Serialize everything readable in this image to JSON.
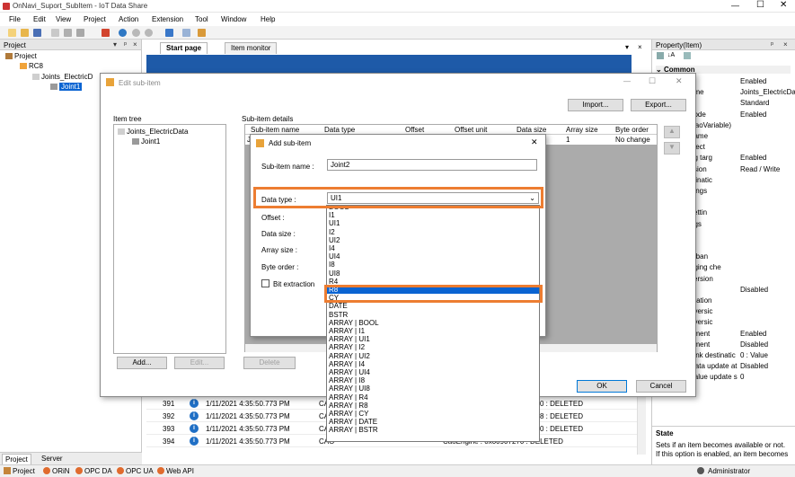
{
  "window": {
    "title": "OnNavi_Suport_SubItem - IoT Data Share"
  },
  "menu": [
    "File",
    "Edit",
    "View",
    "Project",
    "Action",
    "Extension",
    "Tool",
    "Window",
    "Help"
  ],
  "project_panel": {
    "title": "Project",
    "tree": [
      "Project",
      "RC8",
      "Joints_ElectricD",
      "Joint1"
    ]
  },
  "center": {
    "tabs": [
      "Start page",
      "Item monitor"
    ],
    "log_rows": [
      {
        "no": "391",
        "time": "1/11/2021 4:35:50.773 PM",
        "src": "CA",
        "msg": "0 : DELETED"
      },
      {
        "no": "392",
        "time": "1/11/2021 4:35:50.773 PM",
        "src": "CA",
        "msg": "8 : DELETED"
      },
      {
        "no": "393",
        "time": "1/11/2021 4:35:50.773 PM",
        "src": "CA",
        "msg": "0 : DELETED"
      },
      {
        "no": "394",
        "time": "1/11/2021 4:35:50.773 PM",
        "src": "CAO",
        "msg": "CaoEngine : 0x00907270 : DELETED"
      }
    ]
  },
  "property_panel": {
    "title": "Property(Item)",
    "section": "Common",
    "rows": [
      {
        "k": "",
        "v": "Enabled"
      },
      {
        "k": "ame",
        "v": "Joints_ElectricData(Jo"
      },
      {
        "k": "",
        "v": "Standard"
      },
      {
        "k": "node",
        "v": "Enabled"
      },
      {
        "k": "CaoVariable)",
        "v": ""
      },
      {
        "k": "name",
        "v": ""
      },
      {
        "k": "bject",
        "v": ""
      },
      {
        "k": "ng targ",
        "v": "Enabled"
      },
      {
        "k": "ssion",
        "v": "Read / Write"
      },
      {
        "k": "stinatic",
        "v": ""
      },
      {
        "k": "ttings",
        "v": ""
      },
      {
        "k": "n",
        "v": ""
      },
      {
        "k": "settin",
        "v": ""
      },
      {
        "k": "ngs",
        "v": ""
      },
      {
        "k": "er",
        "v": ""
      },
      {
        "k": "d",
        "v": ""
      },
      {
        "k": "n ban",
        "v": ""
      },
      {
        "k": "nging che",
        "v": ""
      },
      {
        "k": "version",
        "v": ""
      },
      {
        "k": "",
        "v": "Disabled"
      },
      {
        "k": "eration",
        "v": ""
      },
      {
        "k": "nversic",
        "v": ""
      },
      {
        "k": "nversic",
        "v": ""
      },
      {
        "k": "ement",
        "v": "Enabled"
      },
      {
        "k": "ement",
        "v": "Disabled"
      },
      {
        "k": "Link destinatic",
        "v": "0 : Value"
      },
      {
        "k": "Data update at",
        "v": "Disabled"
      },
      {
        "k": "Value update s",
        "v": "0"
      }
    ],
    "state_title": "State",
    "state_desc": "Sets if an item becomes available or not. If this option is enabled, an item becomes"
  },
  "bottom_tabs": [
    "Project",
    "Server"
  ],
  "status": {
    "items": [
      "Project",
      "ORiN",
      "OPC DA",
      "OPC UA",
      "Web API"
    ],
    "user": "Administrator"
  },
  "edit_dialog": {
    "title": "Edit sub-item",
    "import": "Import...",
    "export": "Export...",
    "item_tree_label": "Item tree",
    "tree": [
      "Joints_ElectricData",
      "Joint1"
    ],
    "details_label": "Sub-item details",
    "columns": [
      "Sub-item name",
      "Data type",
      "Offset",
      "Offset unit",
      "Data size",
      "Array size",
      "Byte order"
    ],
    "row": {
      "name": "Jo",
      "array": "1",
      "byte": "No change"
    },
    "add": "Add...",
    "edit": "Edit...",
    "delete": "Delete",
    "ok": "OK",
    "cancel": "Cancel"
  },
  "add_dialog": {
    "title": "Add sub-item",
    "name_label": "Sub-item name :",
    "name_value": "Joint2",
    "data_type_label": "Data type :",
    "data_type_value": "UI1",
    "offset_label": "Offset :",
    "data_size_label": "Data size :",
    "array_size_label": "Array size :",
    "byte_order_label": "Byte order :",
    "bit_extraction_label": "Bit extraction",
    "options": [
      "BOOL",
      "I1",
      "UI1",
      "I2",
      "UI2",
      "I4",
      "UI4",
      "I8",
      "UI8",
      "R4",
      "R8",
      "CY",
      "DATE",
      "BSTR",
      "ARRAY | BOOL",
      "ARRAY | I1",
      "ARRAY | UI1",
      "ARRAY | I2",
      "ARRAY | UI2",
      "ARRAY | I4",
      "ARRAY | UI4",
      "ARRAY | I8",
      "ARRAY | UI8",
      "ARRAY | R4",
      "ARRAY | R8",
      "ARRAY | CY",
      "ARRAY | DATE",
      "ARRAY | BSTR"
    ],
    "selected_index": 10
  },
  "colors": {
    "highlight": "#ed7d31",
    "selection": "#0a64d2",
    "banner": "#1e5aa8"
  }
}
